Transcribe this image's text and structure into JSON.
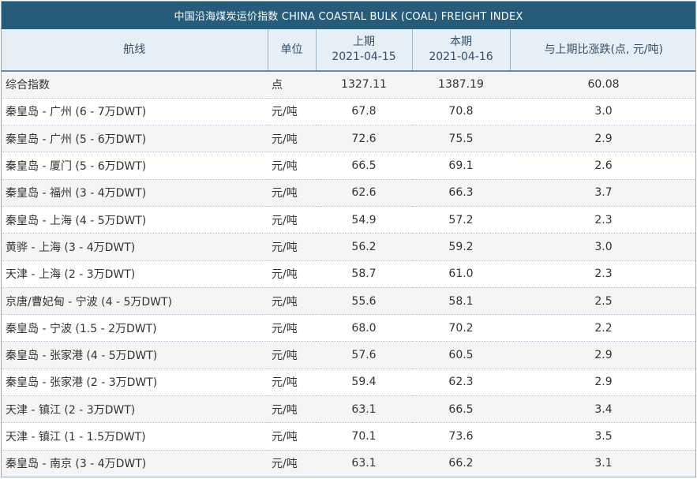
{
  "title": "中国沿海煤炭运价指数 CHINA COASTAL BULK (COAL) FREIGHT INDEX",
  "header": {
    "route": "航线",
    "unit": "单位",
    "prev_label": "上期",
    "prev_date": "2021-04-15",
    "cur_label": "本期",
    "cur_date": "2021-04-16",
    "change": "与上期比涨跌(点, 元/吨)"
  },
  "rows": [
    {
      "route": "综合指数",
      "unit": "点",
      "prev": "1327.11",
      "cur": "1387.19",
      "change": "60.08"
    },
    {
      "route": "秦皇岛 - 广州 (6 - 7万DWT)",
      "unit": "元/吨",
      "prev": "67.8",
      "cur": "70.8",
      "change": "3.0"
    },
    {
      "route": "秦皇岛 - 广州 (5 - 6万DWT)",
      "unit": "元/吨",
      "prev": "72.6",
      "cur": "75.5",
      "change": "2.9"
    },
    {
      "route": "秦皇岛 - 厦门 (5 - 6万DWT)",
      "unit": "元/吨",
      "prev": "66.5",
      "cur": "69.1",
      "change": "2.6"
    },
    {
      "route": "秦皇岛 - 福州 (3 - 4万DWT)",
      "unit": "元/吨",
      "prev": "62.6",
      "cur": "66.3",
      "change": "3.7"
    },
    {
      "route": "秦皇岛 - 上海 (4 - 5万DWT)",
      "unit": "元/吨",
      "prev": "54.9",
      "cur": "57.2",
      "change": "2.3"
    },
    {
      "route": "黄骅 - 上海 (3 - 4万DWT)",
      "unit": "元/吨",
      "prev": "56.2",
      "cur": "59.2",
      "change": "3.0"
    },
    {
      "route": "天津 - 上海 (2 - 3万DWT)",
      "unit": "元/吨",
      "prev": "58.7",
      "cur": "61.0",
      "change": "2.3"
    },
    {
      "route": "京唐/曹妃甸 - 宁波 (4 - 5万DWT)",
      "unit": "元/吨",
      "prev": "55.6",
      "cur": "58.1",
      "change": "2.5"
    },
    {
      "route": "秦皇岛 - 宁波 (1.5 - 2万DWT)",
      "unit": "元/吨",
      "prev": "68.0",
      "cur": "70.2",
      "change": "2.2"
    },
    {
      "route": "秦皇岛 - 张家港 (4 - 5万DWT)",
      "unit": "元/吨",
      "prev": "57.6",
      "cur": "60.5",
      "change": "2.9"
    },
    {
      "route": "秦皇岛 - 张家港 (2 - 3万DWT)",
      "unit": "元/吨",
      "prev": "59.4",
      "cur": "62.3",
      "change": "2.9"
    },
    {
      "route": "天津 - 镇江 (2 - 3万DWT)",
      "unit": "元/吨",
      "prev": "63.1",
      "cur": "66.5",
      "change": "3.4"
    },
    {
      "route": "天津 - 镇江 (1 - 1.5万DWT)",
      "unit": "元/吨",
      "prev": "70.1",
      "cur": "73.6",
      "change": "3.5"
    },
    {
      "route": "秦皇岛 - 南京 (3 - 4万DWT)",
      "unit": "元/吨",
      "prev": "63.1",
      "cur": "66.2",
      "change": "3.1"
    }
  ]
}
